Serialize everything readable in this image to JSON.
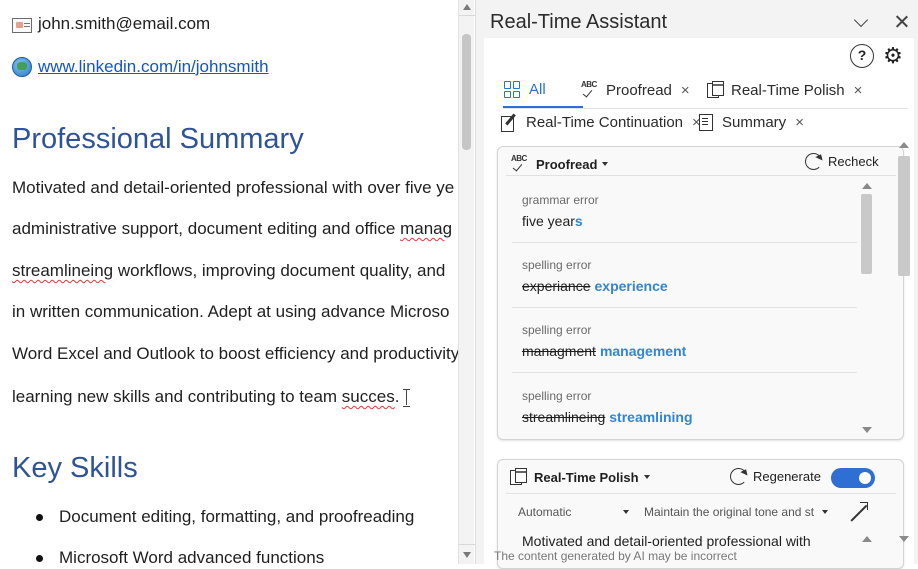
{
  "document": {
    "email": "john.smith@email.com",
    "linkedin": "www.linkedin.com/in/johnsmith",
    "summary_heading": "Professional Summary",
    "summary_lines": [
      [
        "Motivated and detail-oriented professional with over five ye",
        "",
        ""
      ],
      [
        "administrative support, document editing and office ",
        "manag",
        ""
      ],
      [
        "",
        "streamlineing",
        " workflows, improving document quality, and "
      ],
      [
        "in written communication. Adept at using advance Microso",
        "",
        ""
      ],
      [
        "Word Excel and Outlook to boost efficiency and productivity",
        "",
        ""
      ],
      [
        "learning new skills and contributing to team ",
        "succes",
        "."
      ]
    ],
    "skills_heading": "Key Skills",
    "skills": [
      "Document editing, formatting, and proofreading",
      "Microsoft Word advanced functions"
    ]
  },
  "assistant": {
    "title": "Real-Time Assistant",
    "help_label": "?",
    "tabs": [
      {
        "label": "All",
        "icon": "grid-icon",
        "active": true
      },
      {
        "label": "Proofread",
        "icon": "abc-check-icon",
        "closable": true
      },
      {
        "label": "Real-Time Polish",
        "icon": "document-icon",
        "closable": true
      },
      {
        "label": "Real-Time Continuation",
        "icon": "pencil-icon",
        "closable": true
      },
      {
        "label": "Summary",
        "icon": "summary-icon",
        "closable": true
      }
    ],
    "tab_close": "×",
    "proofread": {
      "title": "Proofread",
      "action": "Recheck",
      "errors": [
        {
          "type": "grammar error",
          "original": "five year",
          "added": "s"
        },
        {
          "type": "spelling error",
          "wrong": "experiance",
          "fix": "experience"
        },
        {
          "type": "spelling error",
          "wrong": "managment",
          "fix": "management"
        },
        {
          "type": "spelling error",
          "wrong": "streamlineing",
          "fix": "streamlining"
        }
      ]
    },
    "polish": {
      "title": "Real-Time Polish",
      "action": "Regenerate",
      "enabled": true,
      "mode": "Automatic",
      "tone": "Maintain the original tone and st",
      "preview": "Motivated and detail-oriented professional with"
    },
    "disclaimer": "The content generated by AI may be incorrect",
    "colors": {
      "accent": "#2f6fd3",
      "heading": "#2f5496",
      "fix": "#3385d1"
    }
  }
}
